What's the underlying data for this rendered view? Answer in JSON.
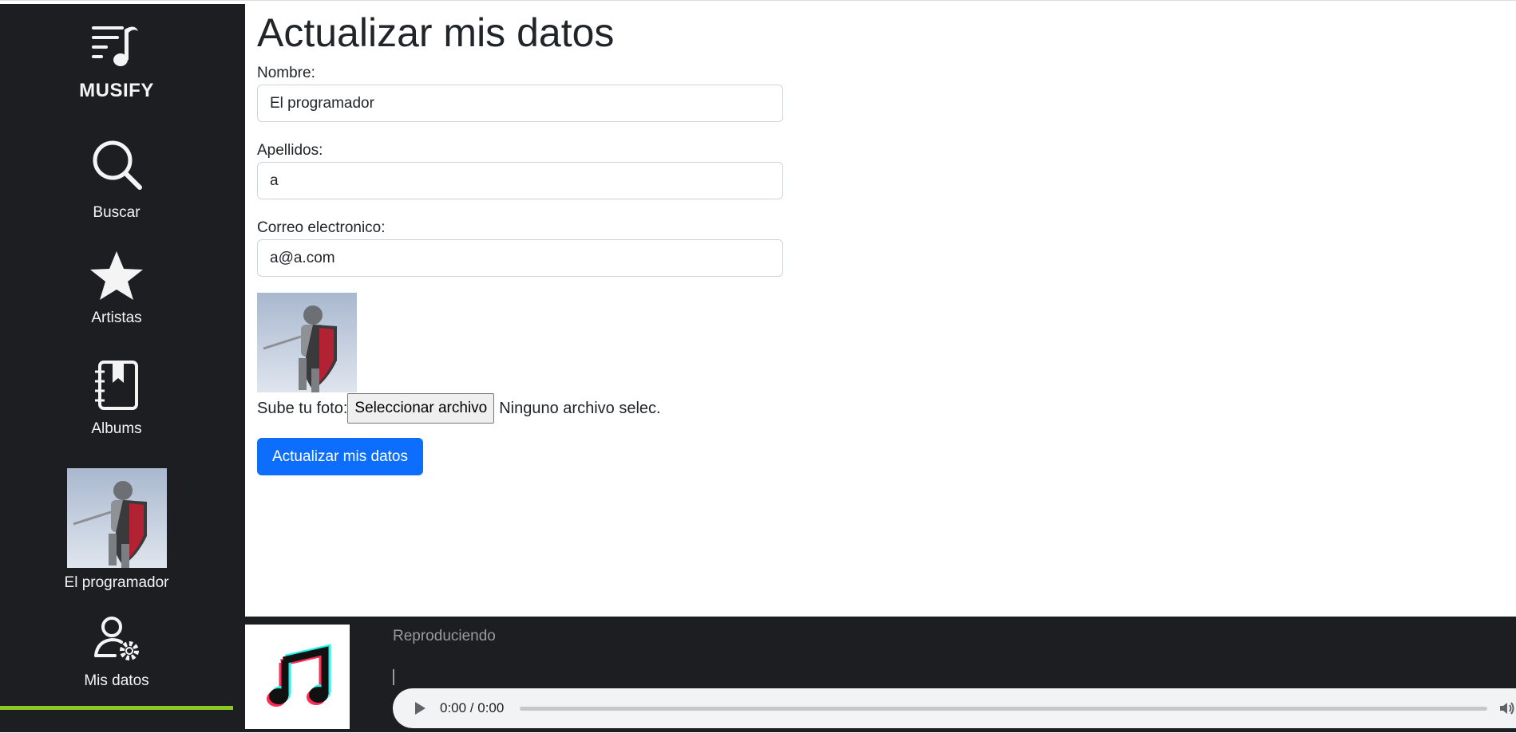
{
  "sidebar": {
    "brand": "MUSIFY",
    "items": [
      {
        "label": "Buscar",
        "icon": "search-icon"
      },
      {
        "label": "Artistas",
        "icon": "star-icon"
      },
      {
        "label": "Albums",
        "icon": "album-book-icon"
      },
      {
        "label": "El programador",
        "icon": "user-avatar"
      },
      {
        "label": "Mis datos",
        "icon": "user-settings-icon"
      }
    ],
    "active_item": "Mis datos",
    "active_color": "#8ac926"
  },
  "main": {
    "title": "Actualizar mis datos",
    "fields": {
      "nombre": {
        "label": "Nombre:",
        "value": "El programador"
      },
      "apellidos": {
        "label": "Apellidos:",
        "value": "a"
      },
      "correo": {
        "label": "Correo electronico:",
        "value": "a@a.com"
      }
    },
    "upload": {
      "label": "Sube tu foto:",
      "button": "Seleccionar archivo",
      "status": "Ninguno archivo selec."
    },
    "submit_label": "Actualizar mis datos",
    "accent": "#0d6efd"
  },
  "player": {
    "now_playing": "Reproduciendo",
    "time": "0:00 / 0:00",
    "cover_icon": "music-note-icon"
  },
  "colors": {
    "sidebar_bg": "#1d1e22"
  }
}
